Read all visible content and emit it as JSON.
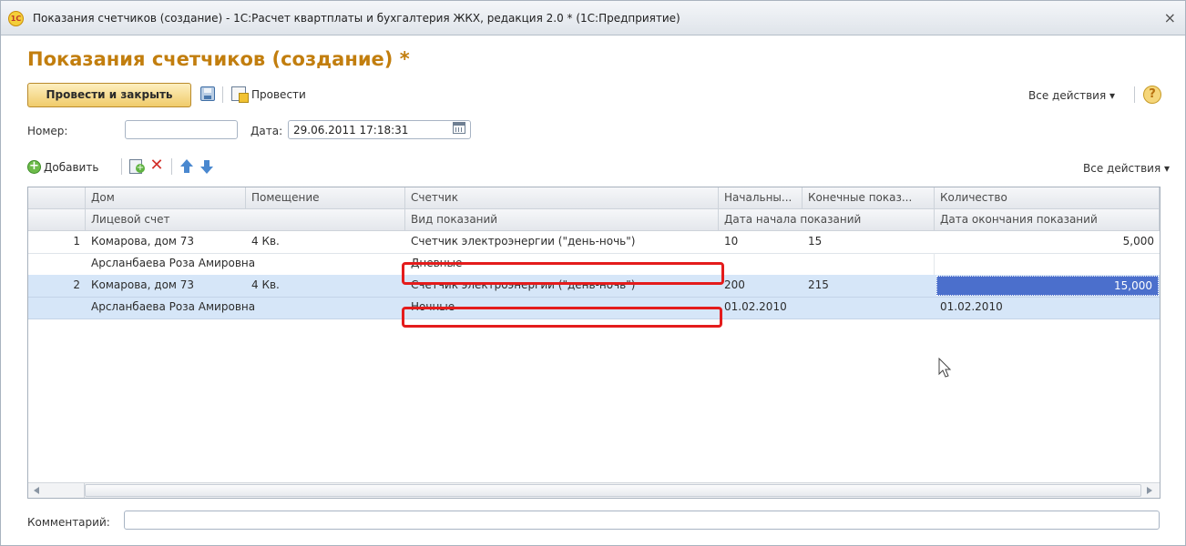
{
  "window": {
    "title": "Показания счетчиков (создание) - 1С:Расчет квартплаты и бухгалтерия ЖКХ, редакция 2.0 * (1С:Предприятие)",
    "logo_text": "1С",
    "close": "×"
  },
  "form": {
    "title": "Показания счетчиков (создание) *"
  },
  "toolbar": {
    "post_and_close": "Провести и закрыть",
    "post": "Провести",
    "all_actions": "Все действия ▾",
    "help": "?"
  },
  "fields": {
    "number_label": "Номер:",
    "number_value": "",
    "date_label": "Дата:",
    "date_value": "29.06.2011 17:18:31"
  },
  "table_toolbar": {
    "add": "Добавить",
    "all_actions": "Все действия ▾"
  },
  "table": {
    "headers_row1": [
      "Дом",
      "Помещение",
      "Счетчик",
      "Начальны...",
      "Конечные показ...",
      "Количество"
    ],
    "headers_row2": [
      "Лицевой счет",
      "Вид показаний",
      "Дата начала показаний",
      "Дата окончания показаний"
    ],
    "rows": [
      {
        "n": "1",
        "house": "Комарова, дом 73",
        "room": "4 Кв.",
        "meter": "Счетчик электроэнергии (\"день-ночь\")",
        "start": "10",
        "end": "15",
        "qty": "5,000",
        "account": "Арсланбаева Роза Амировна",
        "reading_type": "Дневные",
        "start_date": "",
        "end_date": ""
      },
      {
        "n": "2",
        "house": "Комарова, дом 73",
        "room": "4 Кв.",
        "meter": "Счетчик электроэнергии (\"день-ночь\")",
        "start": "200",
        "end": "215",
        "qty": "15,000",
        "account": "Арсланбаева Роза Амировна",
        "reading_type": "Ночные",
        "start_date": "01.02.2010",
        "end_date": "01.02.2010"
      }
    ]
  },
  "comment": {
    "label": "Комментарий:",
    "value": ""
  },
  "colors": {
    "title_orange": "#c27e0e",
    "selection_blue": "#d6e6f8",
    "active_cell": "#4b6fcc",
    "highlight_red": "#e41c1c"
  }
}
